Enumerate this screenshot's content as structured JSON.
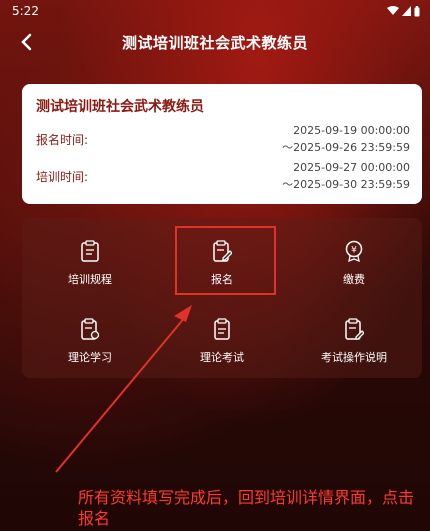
{
  "status_bar": {
    "time": "5:22"
  },
  "header": {
    "title": "测试培训班社会武术教练员"
  },
  "info_card": {
    "title": "测试培训班社会武术教练员",
    "registration": {
      "label": "报名时间:",
      "start": "2025-09-19 00:00:00",
      "end": "～2025-09-26 23:59:59"
    },
    "training": {
      "label": "培训时间:",
      "start": "2025-09-27 00:00:00",
      "end": "～2025-09-30 23:59:59"
    }
  },
  "menu": {
    "items": [
      {
        "label": "培训规程",
        "icon": "document-icon"
      },
      {
        "label": "报名",
        "icon": "edit-document-icon"
      },
      {
        "label": "缴费",
        "icon": "yen-medal-icon"
      },
      {
        "label": "理论学习",
        "icon": "study-document-icon"
      },
      {
        "label": "理论考试",
        "icon": "exam-clipboard-icon"
      },
      {
        "label": "考试操作说明",
        "icon": "instructions-icon"
      }
    ]
  },
  "annotation": {
    "text": "所有资料填写完成后，回到培训详情界面，点击报名",
    "color": "#ff3b2f"
  }
}
